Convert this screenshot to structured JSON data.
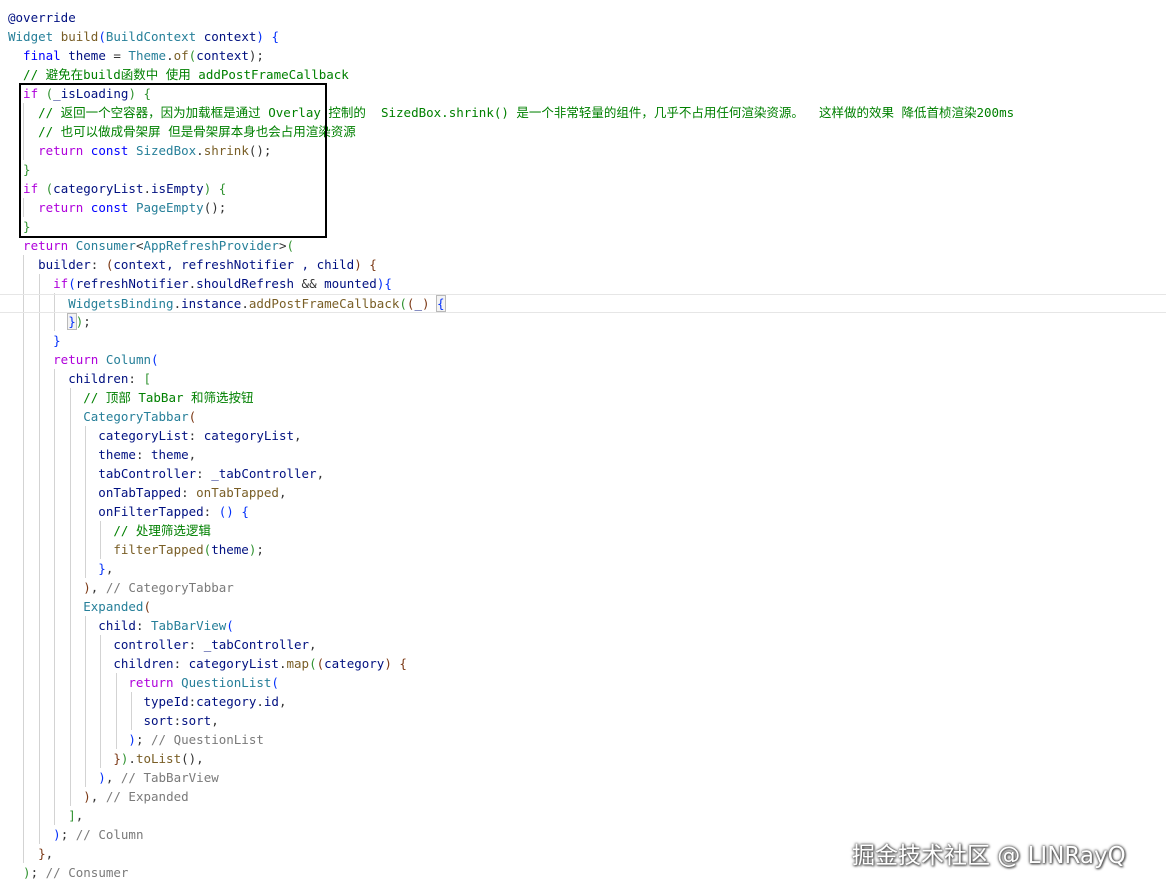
{
  "watermark": "掘金技术社区 @ LINRayQ",
  "code": [
    [
      {
        "t": "@override",
        "c": "t-var"
      }
    ],
    [
      {
        "t": "Widget",
        "c": "t-type"
      },
      {
        "t": " ",
        "c": "t-plain"
      },
      {
        "t": "build",
        "c": "t-fn"
      },
      {
        "t": "(",
        "c": "t-brk"
      },
      {
        "t": "BuildContext",
        "c": "t-type"
      },
      {
        "t": " context",
        "c": "t-var"
      },
      {
        "t": ")",
        "c": "t-brk"
      },
      {
        "t": " {",
        "c": "t-brk"
      }
    ],
    [
      {
        "t": "  final",
        "c": "t-kw"
      },
      {
        "t": " theme",
        "c": "t-var"
      },
      {
        "t": " = ",
        "c": "t-plain"
      },
      {
        "t": "Theme",
        "c": "t-type"
      },
      {
        "t": ".",
        "c": "t-plain"
      },
      {
        "t": "of",
        "c": "t-fn"
      },
      {
        "t": "(",
        "c": "t-brk2"
      },
      {
        "t": "context",
        "c": "t-var"
      },
      {
        "t": ");",
        "c": "t-plain"
      }
    ],
    [
      {
        "t": "  // 避免在build函数中 使用 addPostFrameCallback",
        "c": "t-com"
      }
    ],
    [
      {
        "t": "  if",
        "c": "t-ctl"
      },
      {
        "t": " (",
        "c": "t-brk2"
      },
      {
        "t": "_isLoading",
        "c": "t-var"
      },
      {
        "t": ")",
        "c": "t-brk2"
      },
      {
        "t": " {",
        "c": "t-brk2"
      }
    ],
    [
      {
        "t": "    // 返回一个空容器，因为加载框是通过 Overlay 控制的  SizedBox.shrink() 是一个非常轻量的组件，几乎不占用任何渲染资源。  这样做的效果 降低首桢渲染200ms",
        "c": "t-com"
      }
    ],
    [
      {
        "t": "    // 也可以做成骨架屏 但是骨架屏本身也会占用渲染资源",
        "c": "t-com"
      }
    ],
    [
      {
        "t": "    return",
        "c": "t-ctl"
      },
      {
        "t": " const",
        "c": "t-kw"
      },
      {
        "t": " SizedBox",
        "c": "t-type"
      },
      {
        "t": ".",
        "c": "t-plain"
      },
      {
        "t": "shrink",
        "c": "t-fn"
      },
      {
        "t": "();",
        "c": "t-plain"
      }
    ],
    [
      {
        "t": "  }",
        "c": "t-brk2"
      }
    ],
    [
      {
        "t": "  if",
        "c": "t-ctl"
      },
      {
        "t": " (",
        "c": "t-brk2"
      },
      {
        "t": "categoryList",
        "c": "t-var"
      },
      {
        "t": ".",
        "c": "t-plain"
      },
      {
        "t": "isEmpty",
        "c": "t-var"
      },
      {
        "t": ")",
        "c": "t-brk2"
      },
      {
        "t": " {",
        "c": "t-brk2"
      }
    ],
    [
      {
        "t": "    return",
        "c": "t-ctl"
      },
      {
        "t": " const",
        "c": "t-kw"
      },
      {
        "t": " PageEmpty",
        "c": "t-type"
      },
      {
        "t": "();",
        "c": "t-plain"
      }
    ],
    [
      {
        "t": "  }",
        "c": "t-brk2"
      }
    ],
    [
      {
        "t": "  return",
        "c": "t-ctl"
      },
      {
        "t": " Consumer",
        "c": "t-type"
      },
      {
        "t": "<",
        "c": "t-plain"
      },
      {
        "t": "AppRefreshProvider",
        "c": "t-type"
      },
      {
        "t": ">",
        "c": "t-plain"
      },
      {
        "t": "(",
        "c": "t-brk2"
      }
    ],
    [
      {
        "t": "    builder",
        "c": "t-var"
      },
      {
        "t": ": ",
        "c": "t-plain"
      },
      {
        "t": "(",
        "c": "t-brk3"
      },
      {
        "t": "context, refreshNotifier , child",
        "c": "t-var"
      },
      {
        "t": ")",
        "c": "t-brk3"
      },
      {
        "t": " {",
        "c": "t-brk3"
      }
    ],
    [
      {
        "t": "      if",
        "c": "t-ctl"
      },
      {
        "t": "(",
        "c": "t-brk"
      },
      {
        "t": "refreshNotifier",
        "c": "t-var"
      },
      {
        "t": ".",
        "c": "t-plain"
      },
      {
        "t": "shouldRefresh",
        "c": "t-var"
      },
      {
        "t": " && ",
        "c": "t-plain"
      },
      {
        "t": "mounted",
        "c": "t-var"
      },
      {
        "t": ")",
        "c": "t-brk"
      },
      {
        "t": "{",
        "c": "t-brk"
      }
    ],
    [
      {
        "t": "        WidgetsBinding",
        "c": "t-type"
      },
      {
        "t": ".",
        "c": "t-plain"
      },
      {
        "t": "instance",
        "c": "t-var"
      },
      {
        "t": ".",
        "c": "t-plain"
      },
      {
        "t": "addPostFrameCallback",
        "c": "t-fn"
      },
      {
        "t": "(",
        "c": "t-brk2"
      },
      {
        "t": "(",
        "c": "t-brk3"
      },
      {
        "t": "_",
        "c": "t-var"
      },
      {
        "t": ")",
        "c": "t-brk3"
      },
      {
        "t": " ",
        "c": "t-plain"
      },
      {
        "t": "{",
        "c": "t-brk t-match"
      }
    ],
    [
      {
        "t": "        ",
        "c": "t-plain"
      },
      {
        "t": "}",
        "c": "t-brk t-match"
      },
      {
        "t": ")",
        "c": "t-brk2"
      },
      {
        "t": ";",
        "c": "t-plain"
      }
    ],
    [
      {
        "t": "      }",
        "c": "t-brk"
      }
    ],
    [
      {
        "t": "      return",
        "c": "t-ctl"
      },
      {
        "t": " Column",
        "c": "t-type"
      },
      {
        "t": "(",
        "c": "t-brk"
      }
    ],
    [
      {
        "t": "        children",
        "c": "t-var"
      },
      {
        "t": ": ",
        "c": "t-plain"
      },
      {
        "t": "[",
        "c": "t-brk2"
      }
    ],
    [
      {
        "t": "          // 顶部 TabBar 和筛选按钮",
        "c": "t-com"
      }
    ],
    [
      {
        "t": "          CategoryTabbar",
        "c": "t-type"
      },
      {
        "t": "(",
        "c": "t-brk3"
      }
    ],
    [
      {
        "t": "            categoryList",
        "c": "t-var"
      },
      {
        "t": ": ",
        "c": "t-plain"
      },
      {
        "t": "categoryList",
        "c": "t-var"
      },
      {
        "t": ",",
        "c": "t-plain"
      }
    ],
    [
      {
        "t": "            theme",
        "c": "t-var"
      },
      {
        "t": ": ",
        "c": "t-plain"
      },
      {
        "t": "theme",
        "c": "t-var"
      },
      {
        "t": ",",
        "c": "t-plain"
      }
    ],
    [
      {
        "t": "            tabController",
        "c": "t-var"
      },
      {
        "t": ": ",
        "c": "t-plain"
      },
      {
        "t": "_tabController",
        "c": "t-var"
      },
      {
        "t": ",",
        "c": "t-plain"
      }
    ],
    [
      {
        "t": "            onTabTapped",
        "c": "t-var"
      },
      {
        "t": ": ",
        "c": "t-plain"
      },
      {
        "t": "onTabTapped",
        "c": "t-fn"
      },
      {
        "t": ",",
        "c": "t-plain"
      }
    ],
    [
      {
        "t": "            onFilterTapped",
        "c": "t-var"
      },
      {
        "t": ": ",
        "c": "t-plain"
      },
      {
        "t": "()",
        "c": "t-brk"
      },
      {
        "t": " {",
        "c": "t-brk"
      }
    ],
    [
      {
        "t": "              // 处理筛选逻辑",
        "c": "t-com"
      }
    ],
    [
      {
        "t": "              filterTapped",
        "c": "t-fn"
      },
      {
        "t": "(",
        "c": "t-brk2"
      },
      {
        "t": "theme",
        "c": "t-var"
      },
      {
        "t": ")",
        "c": "t-brk2"
      },
      {
        "t": ";",
        "c": "t-plain"
      }
    ],
    [
      {
        "t": "            }",
        "c": "t-brk"
      },
      {
        "t": ",",
        "c": "t-plain"
      }
    ],
    [
      {
        "t": "          )",
        "c": "t-brk3"
      },
      {
        "t": ", ",
        "c": "t-plain"
      },
      {
        "t": "// CategoryTabbar",
        "c": "t-hint"
      }
    ],
    [
      {
        "t": "          Expanded",
        "c": "t-type"
      },
      {
        "t": "(",
        "c": "t-brk3"
      }
    ],
    [
      {
        "t": "            child",
        "c": "t-var"
      },
      {
        "t": ": ",
        "c": "t-plain"
      },
      {
        "t": "TabBarView",
        "c": "t-type"
      },
      {
        "t": "(",
        "c": "t-brk"
      }
    ],
    [
      {
        "t": "              controller",
        "c": "t-var"
      },
      {
        "t": ": ",
        "c": "t-plain"
      },
      {
        "t": "_tabController",
        "c": "t-var"
      },
      {
        "t": ",",
        "c": "t-plain"
      }
    ],
    [
      {
        "t": "              children",
        "c": "t-var"
      },
      {
        "t": ": ",
        "c": "t-plain"
      },
      {
        "t": "categoryList",
        "c": "t-var"
      },
      {
        "t": ".",
        "c": "t-plain"
      },
      {
        "t": "map",
        "c": "t-fn"
      },
      {
        "t": "(",
        "c": "t-brk2"
      },
      {
        "t": "(",
        "c": "t-brk3"
      },
      {
        "t": "category",
        "c": "t-var"
      },
      {
        "t": ")",
        "c": "t-brk3"
      },
      {
        "t": " {",
        "c": "t-brk3"
      }
    ],
    [
      {
        "t": "                return",
        "c": "t-ctl"
      },
      {
        "t": " QuestionList",
        "c": "t-type"
      },
      {
        "t": "(",
        "c": "t-brk"
      }
    ],
    [
      {
        "t": "                  typeId",
        "c": "t-var"
      },
      {
        "t": ":",
        "c": "t-plain"
      },
      {
        "t": "category",
        "c": "t-var"
      },
      {
        "t": ".",
        "c": "t-plain"
      },
      {
        "t": "id",
        "c": "t-var"
      },
      {
        "t": ",",
        "c": "t-plain"
      }
    ],
    [
      {
        "t": "                  sort",
        "c": "t-var"
      },
      {
        "t": ":",
        "c": "t-plain"
      },
      {
        "t": "sort",
        "c": "t-var"
      },
      {
        "t": ",",
        "c": "t-plain"
      }
    ],
    [
      {
        "t": "                )",
        "c": "t-brk"
      },
      {
        "t": "; ",
        "c": "t-plain"
      },
      {
        "t": "// QuestionList",
        "c": "t-hint"
      }
    ],
    [
      {
        "t": "              }",
        "c": "t-brk3"
      },
      {
        "t": ")",
        "c": "t-brk2"
      },
      {
        "t": ".",
        "c": "t-plain"
      },
      {
        "t": "toList",
        "c": "t-fn"
      },
      {
        "t": "(),",
        "c": "t-plain"
      }
    ],
    [
      {
        "t": "            )",
        "c": "t-brk"
      },
      {
        "t": ", ",
        "c": "t-plain"
      },
      {
        "t": "// TabBarView",
        "c": "t-hint"
      }
    ],
    [
      {
        "t": "          )",
        "c": "t-brk3"
      },
      {
        "t": ", ",
        "c": "t-plain"
      },
      {
        "t": "// Expanded",
        "c": "t-hint"
      }
    ],
    [
      {
        "t": "        ]",
        "c": "t-brk2"
      },
      {
        "t": ",",
        "c": "t-plain"
      }
    ],
    [
      {
        "t": "      )",
        "c": "t-brk"
      },
      {
        "t": "; ",
        "c": "t-plain"
      },
      {
        "t": "// Column",
        "c": "t-hint"
      }
    ],
    [
      {
        "t": "    }",
        "c": "t-brk3"
      },
      {
        "t": ",",
        "c": "t-plain"
      }
    ],
    [
      {
        "t": "  )",
        "c": "t-brk2"
      },
      {
        "t": "; ",
        "c": "t-plain"
      },
      {
        "t": "// Consumer",
        "c": "t-hint"
      }
    ]
  ]
}
